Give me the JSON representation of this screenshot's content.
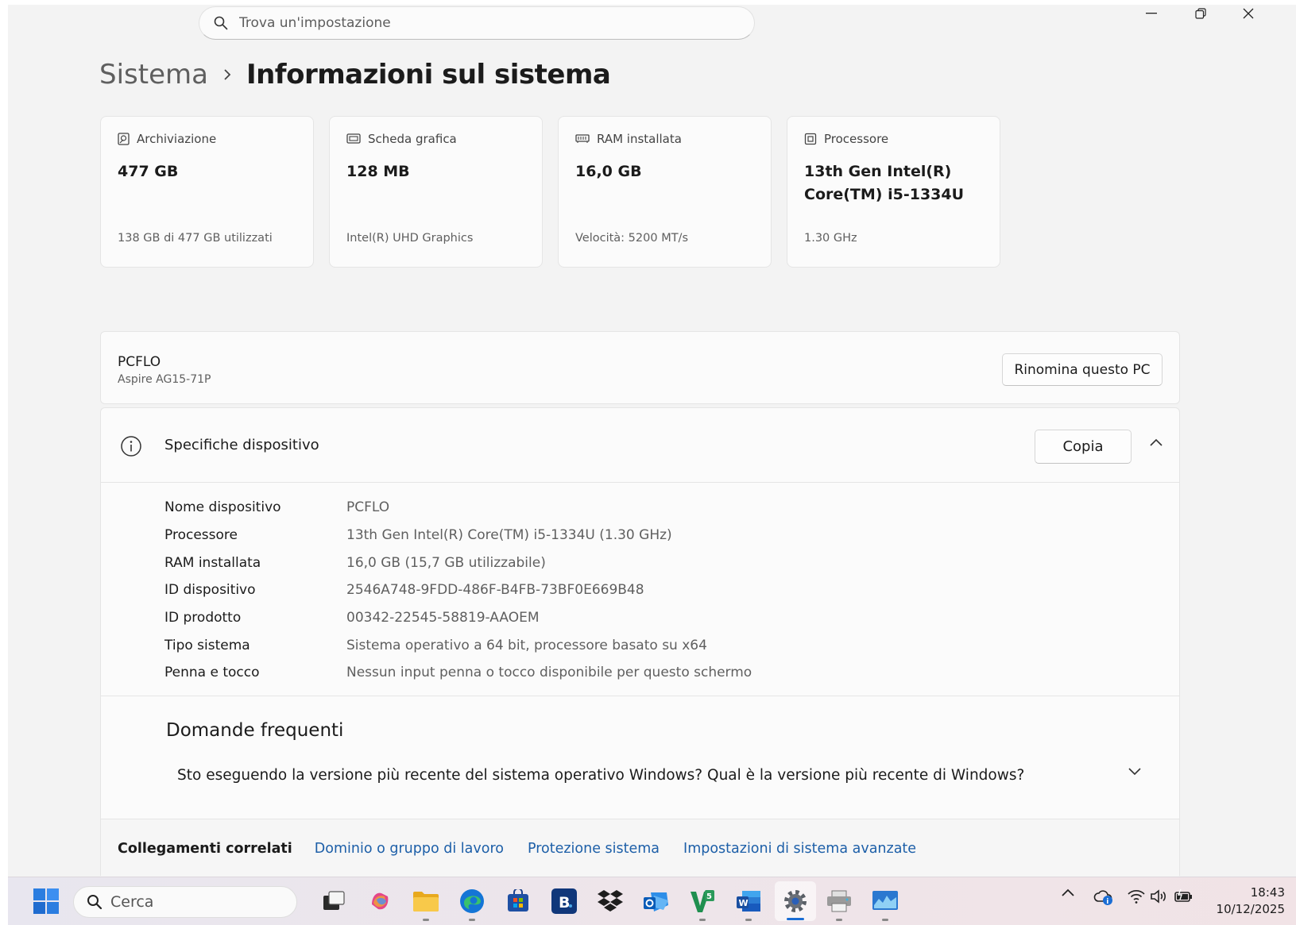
{
  "search": {
    "placeholder": "Trova un'impostazione"
  },
  "breadcrumb": {
    "parent": "Sistema",
    "current": "Informazioni sul sistema"
  },
  "cards": [
    {
      "label": "Archiviazione",
      "value": "477 GB",
      "sub": "138 GB di 477 GB utilizzati",
      "icon": "storage-icon"
    },
    {
      "label": "Scheda grafica",
      "value": "128 MB",
      "sub": "Intel(R) UHD Graphics",
      "icon": "graphics-card-icon"
    },
    {
      "label": "RAM installata",
      "value": "16,0 GB",
      "sub": "Velocità: 5200 MT/s",
      "icon": "ram-icon"
    },
    {
      "label": "Processore",
      "value": "13th Gen Intel(R) Core(TM) i5-1334U",
      "sub": "1.30 GHz",
      "icon": "processor-icon"
    }
  ],
  "pc": {
    "name": "PCFLO",
    "model": "Aspire AG15-71P",
    "rename_label": "Rinomina questo PC"
  },
  "specs": {
    "title": "Specifiche dispositivo",
    "copy_label": "Copia",
    "rows": [
      {
        "key": "Nome dispositivo",
        "value": "PCFLO"
      },
      {
        "key": "Processore",
        "value": "13th Gen Intel(R) Core(TM) i5-1334U (1.30 GHz)"
      },
      {
        "key": "RAM installata",
        "value": "16,0 GB (15,7 GB utilizzabile)"
      },
      {
        "key": "ID dispositivo",
        "value": "2546A748-9FDD-486F-B4FB-73BF0E669B48"
      },
      {
        "key": "ID prodotto",
        "value": "00342-22545-58819-AAOEM"
      },
      {
        "key": "Tipo sistema",
        "value": "Sistema operativo a 64 bit, processore basato su x64"
      },
      {
        "key": "Penna e tocco",
        "value": "Nessun input penna o tocco disponibile per questo schermo"
      }
    ]
  },
  "faq": {
    "title": "Domande frequenti",
    "question": "Sto eseguendo la versione più recente del sistema operativo Windows? Qual è la versione più recente di Windows?"
  },
  "related": {
    "label": "Collegamenti correlati",
    "links": [
      "Dominio o gruppo di lavoro",
      "Protezione sistema",
      "Impostazioni di sistema avanzate"
    ]
  },
  "taskbar": {
    "search_label": "Cerca",
    "time": "18:43",
    "date": "10/12/2025"
  },
  "colors": {
    "accent": "#1a6dd4",
    "link": "#1d5fa8",
    "background": "#f3f3f3",
    "card": "#fbfbfb"
  }
}
